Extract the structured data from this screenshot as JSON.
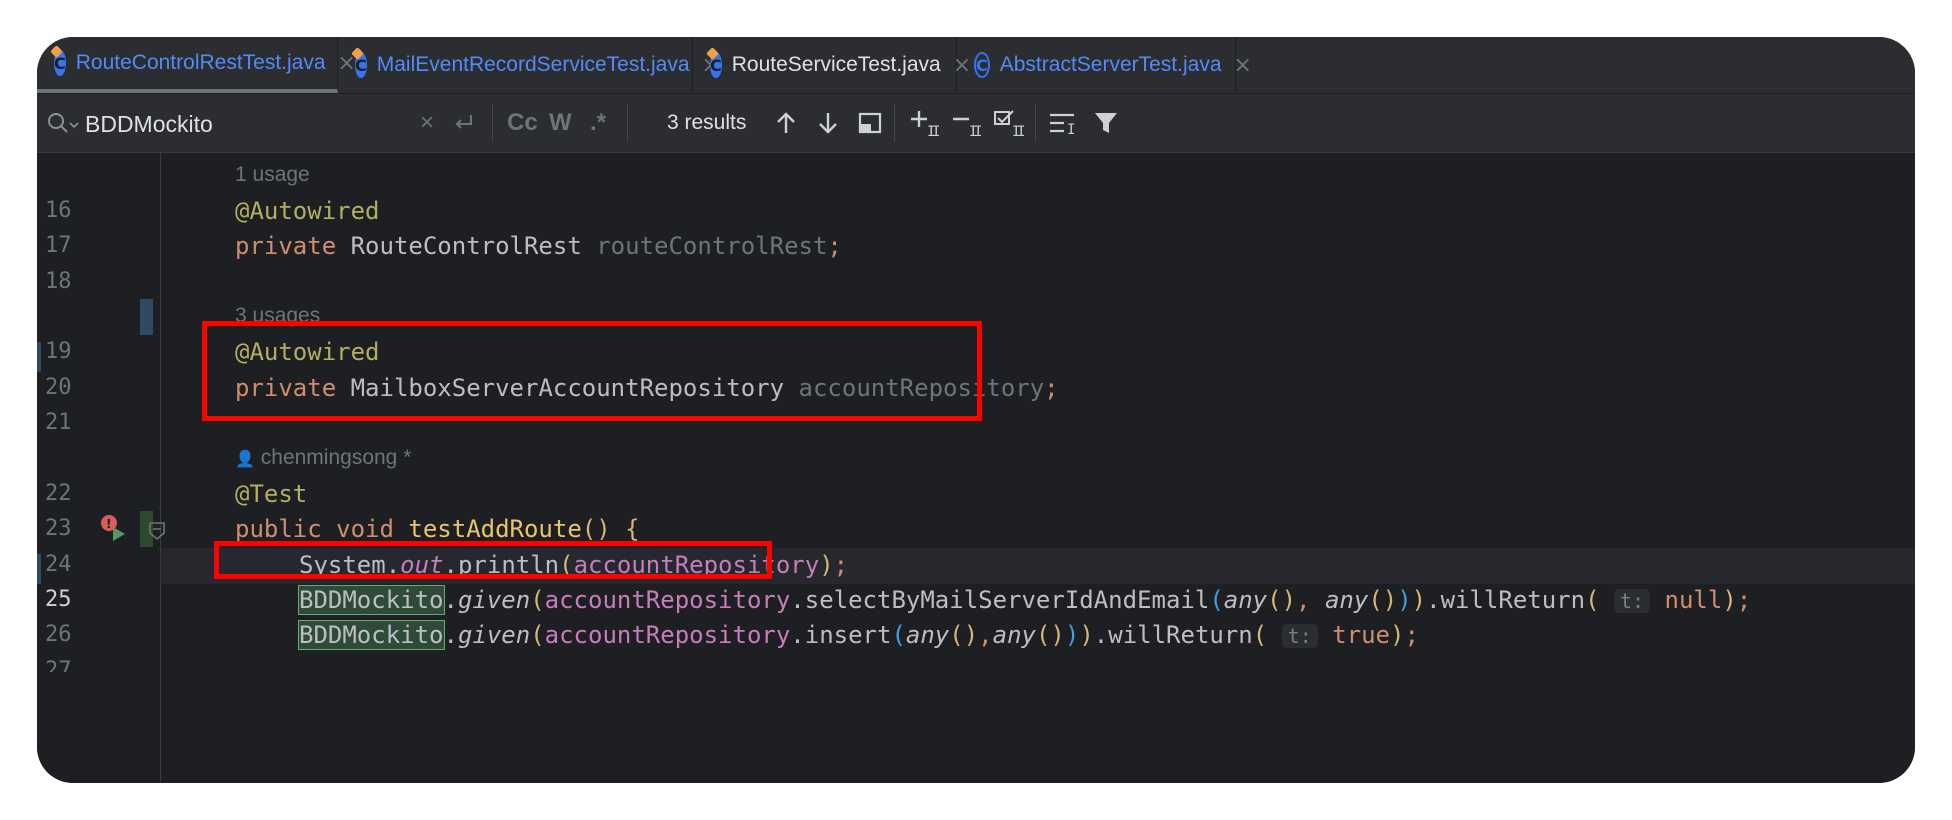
{
  "tabs": [
    {
      "label": "RouteControlRestTest.java",
      "icon": "java-test-class-icon",
      "color": "#548af7"
    },
    {
      "label": "MailEventRecordServiceTest.java",
      "icon": "java-test-class-icon",
      "color": "#548af7"
    },
    {
      "label": "RouteServiceTest.java",
      "icon": "java-test-class-icon",
      "color": "#dfe1e5"
    },
    {
      "label": "AbstractServerTest.java",
      "icon": "java-abstract-class-icon",
      "color": "#548af7"
    }
  ],
  "search": {
    "query": "BDDMockito",
    "match_case": "Cc",
    "words": "W",
    "regex": ".*",
    "results": "3 results"
  },
  "editor": {
    "usage_hint_1": "1 usage",
    "usage_hint_2": "3 usages",
    "author_hint": "chenmingsong *",
    "lines": [
      {
        "no": "16",
        "text": "@Autowired"
      },
      {
        "no": "17",
        "text": "private RouteControlRest routeControlRest;"
      },
      {
        "no": "18",
        "text": ""
      },
      {
        "no": "19",
        "text": "@Autowired"
      },
      {
        "no": "20",
        "text": "private MailboxServerAccountRepository accountRepository;"
      },
      {
        "no": "21",
        "text": ""
      },
      {
        "no": "22",
        "text": "@Test"
      },
      {
        "no": "23",
        "text": "public void testAddRoute() {"
      },
      {
        "no": "24",
        "text": "System.out.println(accountRepository);"
      },
      {
        "no": "25",
        "text": "BDDMockito.given(accountRepository.selectByMailServerIdAndEmail(any(), any())).willReturn( t: null);"
      },
      {
        "no": "26",
        "text": "BDDMockito.given(accountRepository.insert(any(),any())).willReturn( t: true);"
      }
    ],
    "inlay_param": "t:"
  },
  "colors": {
    "highlight_box": "#ff0000",
    "annotation": "#b3ae60",
    "keyword": "#cf8e6d",
    "field": "#c77dbb",
    "method": "#56a8f5"
  }
}
